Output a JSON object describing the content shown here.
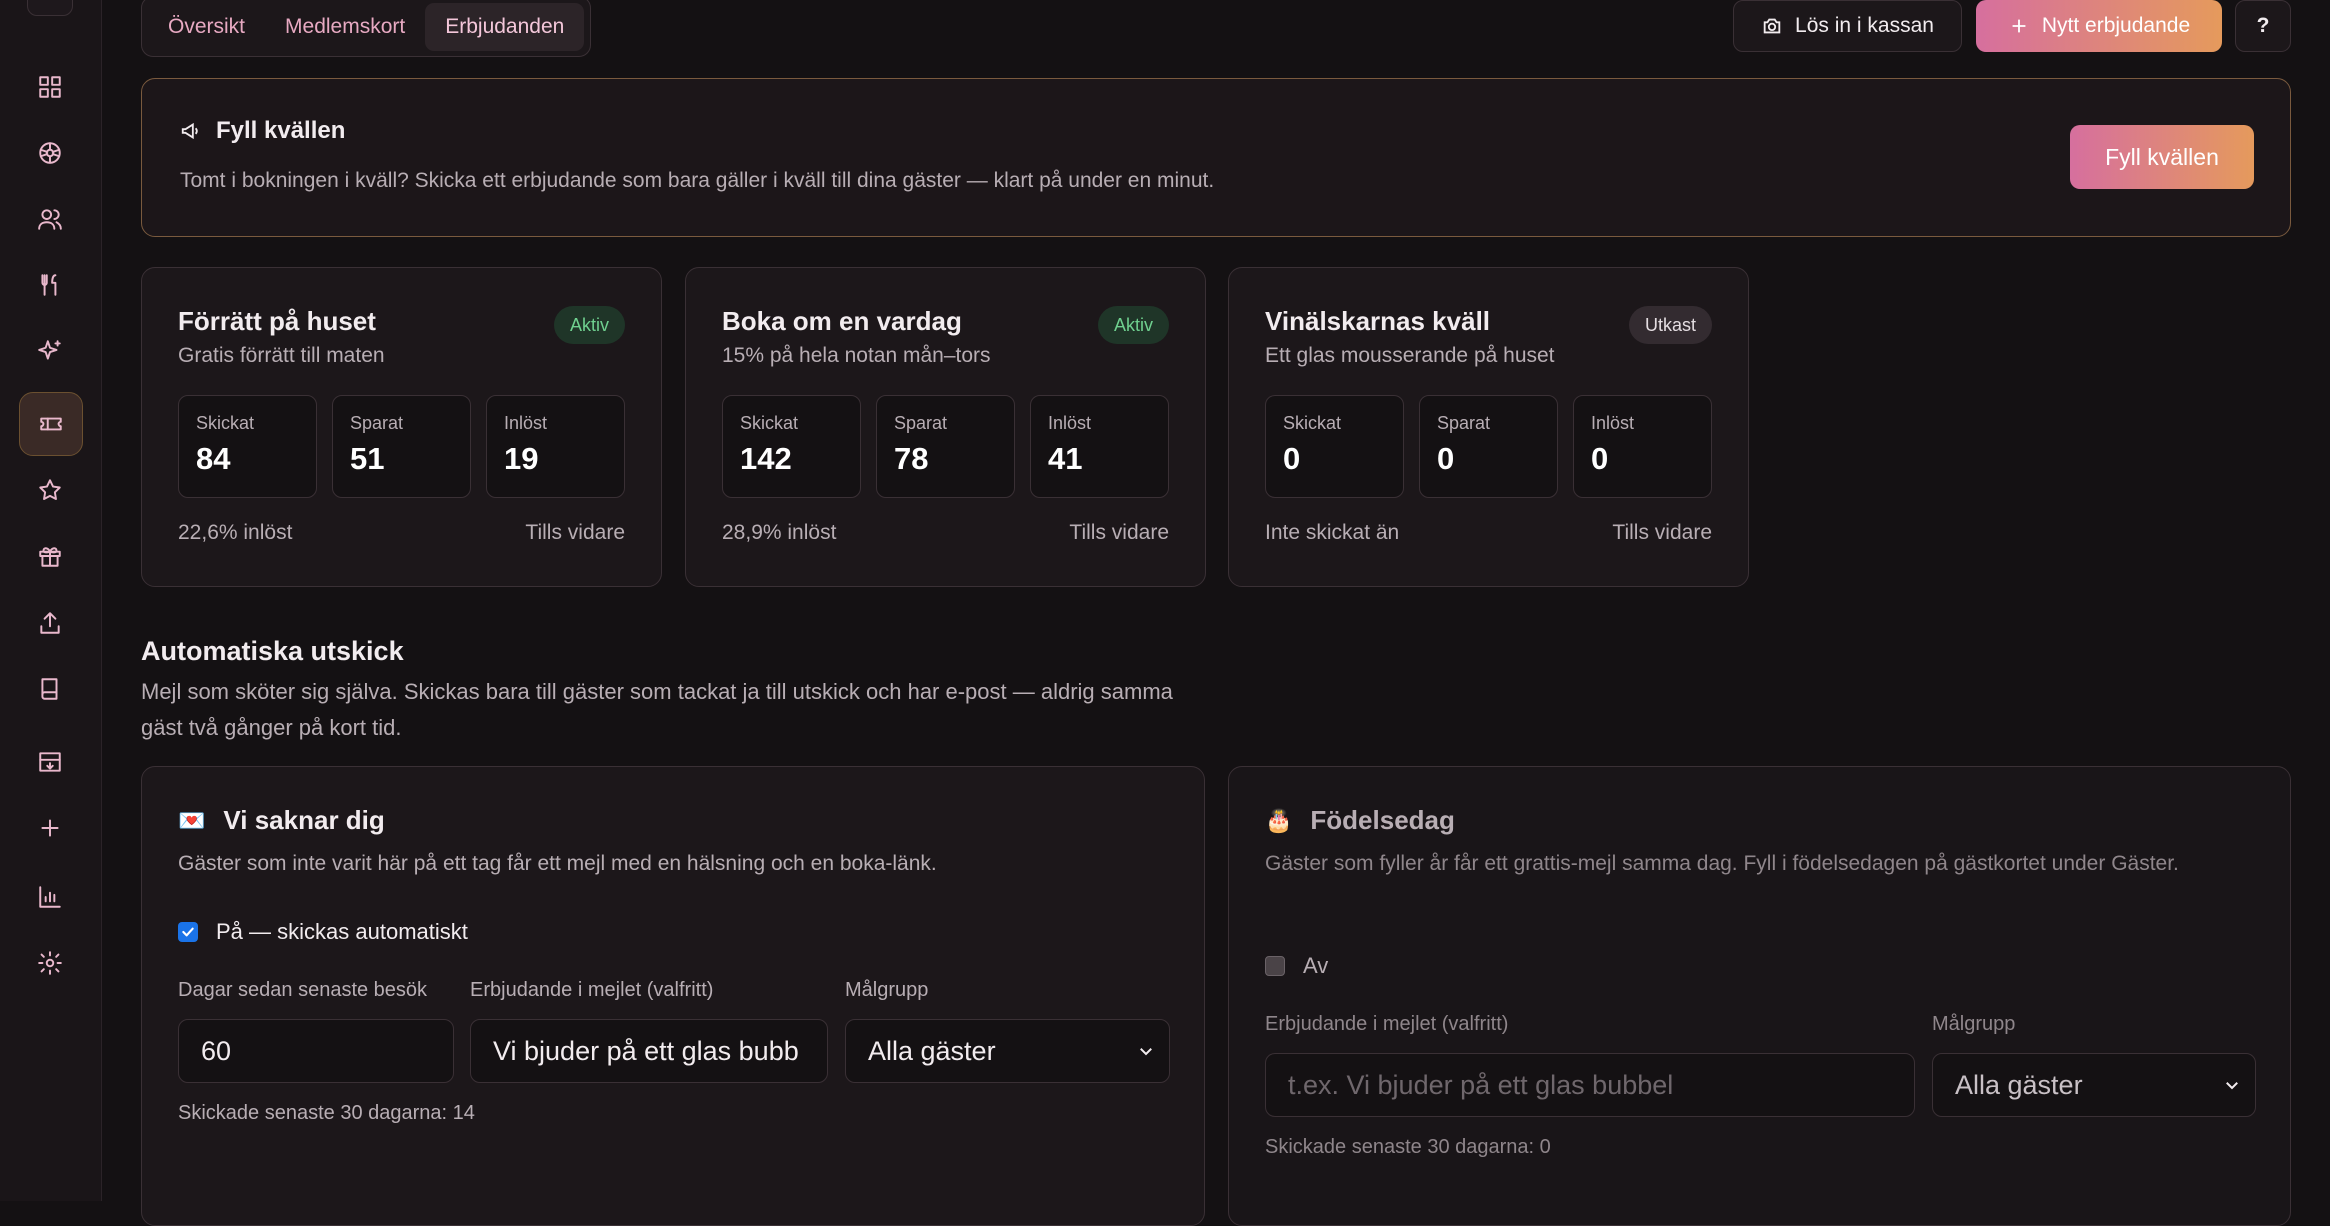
{
  "sidebar": {
    "icons": [
      "grid-icon",
      "palette-icon",
      "users-icon",
      "utensils-icon",
      "sparkles-icon",
      "ticket-icon",
      "star-icon",
      "gift-icon",
      "upload-icon",
      "book-icon",
      "archive-icon",
      "plus-icon",
      "bar-chart-icon",
      "settings-users-icon"
    ],
    "active": "ticket-icon"
  },
  "tabs": [
    {
      "label": "Översikt"
    },
    {
      "label": "Medlemskort"
    },
    {
      "label": "Erbjudanden"
    }
  ],
  "header": {
    "pos_login_label": "Lös in i kassan",
    "new_offer_label": "Nytt erbjudande",
    "help_label": "?"
  },
  "banner": {
    "title": "Fyll kvällen",
    "description": "Tomt i bokningen i kväll? Skicka ett erbjudande som bara gäller i kväll till dina gäster — klart på under en minut.",
    "button_label": "Fyll kvällen"
  },
  "offers": [
    {
      "title": "Förrätt på huset",
      "subtitle": "Gratis förrätt till maten",
      "status": "Aktiv",
      "stats": [
        {
          "label": "Skickat",
          "value": "84"
        },
        {
          "label": "Sparat",
          "value": "51"
        },
        {
          "label": "Inlöst",
          "value": "19"
        }
      ],
      "rate": "22,6% inlöst",
      "validity": "Tills vidare"
    },
    {
      "title": "Boka om en vardag",
      "subtitle": "15% på hela notan mån–tors",
      "status": "Aktiv",
      "stats": [
        {
          "label": "Skickat",
          "value": "142"
        },
        {
          "label": "Sparat",
          "value": "78"
        },
        {
          "label": "Inlöst",
          "value": "41"
        }
      ],
      "rate": "28,9% inlöst",
      "validity": "Tills vidare"
    },
    {
      "title": "Vinälskarnas kväll",
      "subtitle": "Ett glas mousserande på huset",
      "status": "Utkast",
      "stats": [
        {
          "label": "Skickat",
          "value": "0"
        },
        {
          "label": "Sparat",
          "value": "0"
        },
        {
          "label": "Inlöst",
          "value": "0"
        }
      ],
      "rate": "Inte skickat än",
      "validity": "Tills vidare"
    }
  ],
  "automations": {
    "title": "Automatiska utskick",
    "description": "Mejl som sköter sig själva. Skickas bara till gäster som tackat ja till utskick och har e-post — aldrig samma gäst två gånger på kort tid.",
    "miss_you": {
      "emoji": "💌",
      "title": "Vi saknar dig",
      "description": "Gäster som inte varit här på ett tag får ett mejl med en hälsning och en boka-länk.",
      "toggle_label": "På — skickas automatiskt",
      "enabled": true,
      "days_label": "Dagar sedan senaste besök",
      "days_value": "60",
      "offer_label": "Erbjudande i mejlet (valfritt)",
      "offer_value": "Vi bjuder på ett glas bubb",
      "audience_label": "Målgrupp",
      "audience_value": "Alla gäster",
      "sent_text": "Skickade senaste 30 dagarna: 14"
    },
    "birthday": {
      "emoji": "🎂",
      "title": "Födelsedag",
      "description": "Gäster som fyller år får ett grattis-mejl samma dag. Fyll i födelsedagen på gästkortet under Gäster.",
      "toggle_label": "Av",
      "enabled": false,
      "offer_label": "Erbjudande i mejlet (valfritt)",
      "offer_placeholder": "t.ex. Vi bjuder på ett glas bubbel",
      "audience_label": "Målgrupp",
      "audience_value": "Alla gäster",
      "sent_text": "Skickade senaste 30 dagarna: 0"
    }
  }
}
